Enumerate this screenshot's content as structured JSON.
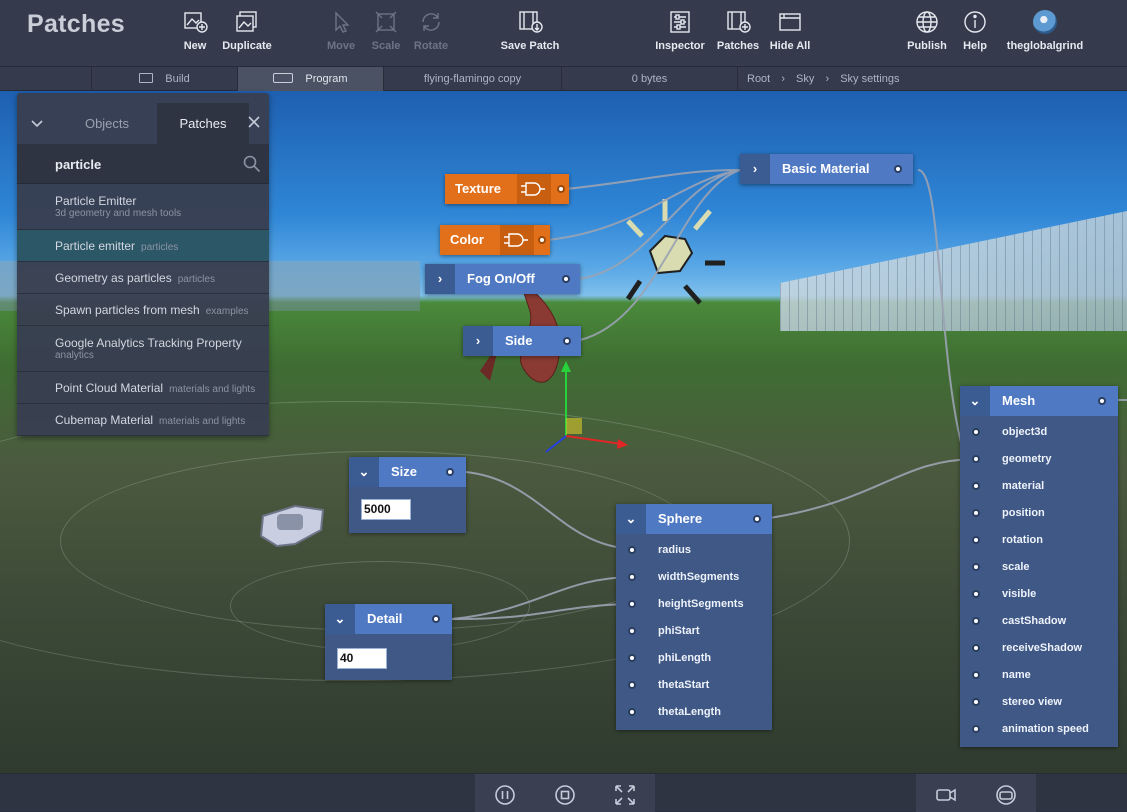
{
  "app": {
    "title": "Patches"
  },
  "toolbar": {
    "new": "New",
    "duplicate": "Duplicate",
    "move": "Move",
    "scale": "Scale",
    "rotate": "Rotate",
    "save_patch": "Save Patch",
    "inspector": "Inspector",
    "patches": "Patches",
    "hide_all": "Hide All",
    "publish": "Publish",
    "help": "Help",
    "user": "theglobalgrind"
  },
  "subbar": {
    "build": "Build",
    "program": "Program",
    "project": "flying-flamingo copy",
    "size": "0 bytes",
    "breadcrumb": [
      "Root",
      "Sky",
      "Sky settings"
    ]
  },
  "panel": {
    "tabs": [
      "Objects",
      "Patches"
    ],
    "search_value": "particle",
    "results": [
      {
        "name": "Particle Emitter",
        "category": "3d geometry and mesh tools",
        "layout": "below"
      },
      {
        "name": "Particle emitter",
        "category": "particles",
        "layout": "inline",
        "selected": true
      },
      {
        "name": "Geometry as particles",
        "category": "particles",
        "layout": "inline"
      },
      {
        "name": "Spawn particles from mesh",
        "category": "examples",
        "layout": "inline"
      },
      {
        "name": "Google Analytics Tracking Property",
        "category": "analytics",
        "layout": "below"
      },
      {
        "name": "Point Cloud Material",
        "category": "materials and lights",
        "layout": "inline"
      },
      {
        "name": "Cubemap Material",
        "category": "materials and lights",
        "layout": "inline"
      }
    ]
  },
  "nodes": {
    "texture": "Texture",
    "color": "Color",
    "fog": "Fog On/Off",
    "side": "Side",
    "basic_material": "Basic Material",
    "size": {
      "title": "Size",
      "value": "5000"
    },
    "detail": {
      "title": "Detail",
      "value": "40"
    },
    "sphere": {
      "title": "Sphere",
      "ports": [
        "radius",
        "widthSegments",
        "heightSegments",
        "phiStart",
        "phiLength",
        "thetaStart",
        "thetaLength"
      ]
    },
    "mesh": {
      "title": "Mesh",
      "ports": [
        "object3d",
        "geometry",
        "material",
        "position",
        "rotation",
        "scale",
        "visible",
        "castShadow",
        "receiveShadow",
        "name",
        "stereo view",
        "animation speed"
      ]
    }
  }
}
